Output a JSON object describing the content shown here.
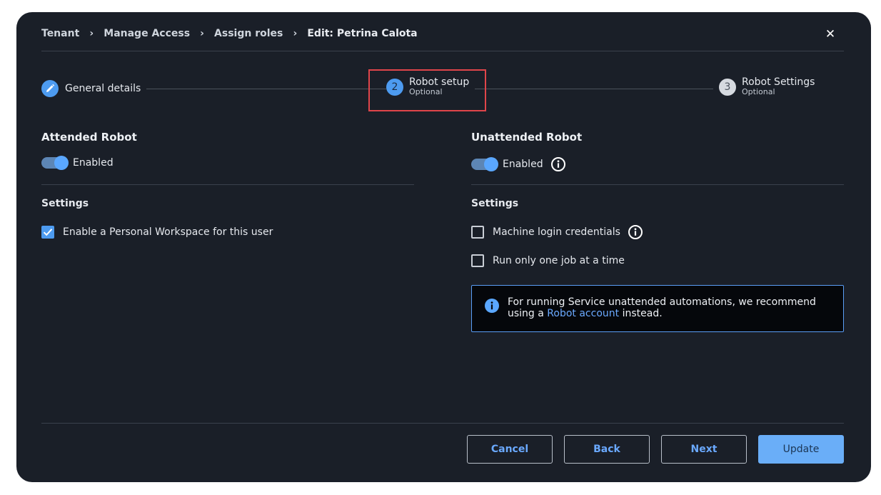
{
  "breadcrumb": {
    "items": [
      "Tenant",
      "Manage Access",
      "Assign roles",
      "Edit: Petrina Calota"
    ]
  },
  "stepper": {
    "steps": [
      {
        "number": "",
        "label": "General details",
        "sub": "",
        "icon": "pencil-icon"
      },
      {
        "number": "2",
        "label": "Robot setup",
        "sub": "Optional"
      },
      {
        "number": "3",
        "label": "Robot Settings",
        "sub": "Optional"
      }
    ]
  },
  "attended": {
    "title": "Attended Robot",
    "toggle_label": "Enabled",
    "settings_title": "Settings",
    "personal_workspace_label": "Enable a Personal Workspace for this user",
    "personal_workspace_checked": true
  },
  "unattended": {
    "title": "Unattended Robot",
    "toggle_label": "Enabled",
    "settings_title": "Settings",
    "machine_login_label": "Machine login credentials",
    "run_one_job_label": "Run only one job at a time",
    "info_text_before": "For running Service unattended automations, we recommend using a ",
    "info_link": "Robot account",
    "info_text_after": " instead."
  },
  "footer": {
    "cancel": "Cancel",
    "back": "Back",
    "next": "Next",
    "update": "Update"
  },
  "colors": {
    "background": "#1a1f28",
    "accent": "#4d9bf0",
    "highlight": "#e0454a"
  }
}
